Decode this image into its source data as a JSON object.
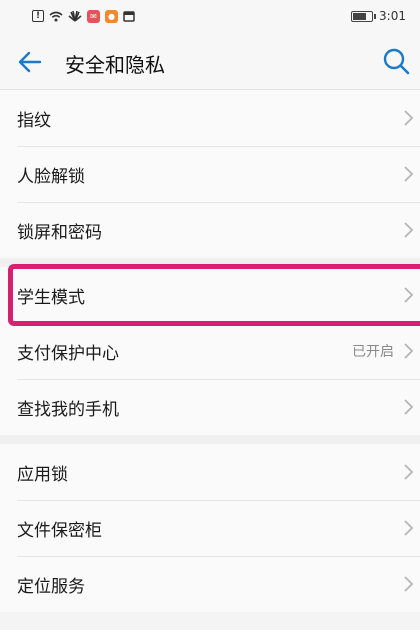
{
  "status": {
    "time": "3:01"
  },
  "header": {
    "title": "安全和隐私"
  },
  "groups": [
    {
      "items": [
        {
          "label": "指纹"
        },
        {
          "label": "人脸解锁"
        },
        {
          "label": "锁屏和密码"
        }
      ]
    },
    {
      "items": [
        {
          "label": "学生模式"
        },
        {
          "label": "支付保护中心",
          "value": "已开启"
        },
        {
          "label": "查找我的手机"
        }
      ]
    },
    {
      "items": [
        {
          "label": "应用锁"
        },
        {
          "label": "文件保密柜"
        },
        {
          "label": "定位服务"
        }
      ]
    }
  ],
  "colors": {
    "accent": "#1a7ac9",
    "highlight": "#d7206f"
  }
}
